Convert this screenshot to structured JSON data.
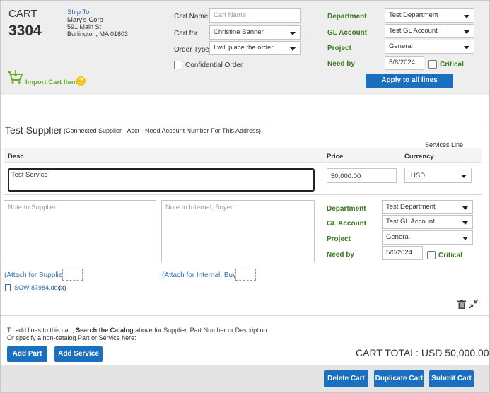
{
  "header": {
    "cart_label": "CART",
    "cart_number": "3304",
    "ship_to_label": "Ship To",
    "ship_to_name": "Mary's Corp",
    "ship_to_street": "591 Main St",
    "ship_to_city": "Burlington, MA 01803",
    "cart_name_label": "Cart Name",
    "cart_name_placeholder": "Cart Name",
    "cart_for_label": "Cart for",
    "cart_for_value": "Christine Banner",
    "order_type_label": "Order Type",
    "order_type_value": "I will place the order",
    "confidential_label": "Confidential Order",
    "department_label": "Department",
    "department_value": "Test Department",
    "gl_account_label": "GL Account",
    "gl_account_value": "Test GL Account",
    "project_label": "Project",
    "project_value": "General",
    "need_by_label": "Need by",
    "need_by_value": "5/6/2024",
    "critical_label": "Critical",
    "import_label": "Import Cart Items",
    "help_glyph": "?",
    "apply_label": "Apply to all lines"
  },
  "supplier": {
    "name": "Test Supplier",
    "note": "(Connected Supplier - Acct - Need Account Number For This Address)",
    "services_line_label": "Services Line",
    "desc_header": "Desc",
    "price_header": "Price",
    "currency_header": "Currency",
    "desc_value": "Test Service",
    "price_value": "50,000.00",
    "currency_value": "USD",
    "note_supplier_placeholder": "Note to Supplier",
    "note_internal_placeholder": "Note to Internal, Buyer",
    "department_label": "Department",
    "department_value": "Test Department",
    "gl_account_label": "GL Account",
    "gl_account_value": "Test GL Account",
    "project_label": "Project",
    "project_value": "General",
    "need_by_label": "Need by",
    "need_by_value": "5/6/2024",
    "critical_label": "Critical",
    "attach_supplier_label": "(Attach for Supplier)",
    "attach_internal_label": "(Attach for Internal, Buyer)",
    "attachment_name": "SOW 87984.docx",
    "attachment_remove": "(x)"
  },
  "footer": {
    "hint_line1_prefix": "To add lines to this cart, ",
    "hint_line1_bold": "Search the Catalog",
    "hint_line1_suffix": " above for Supplier, Part Number or Description.",
    "hint_line2": "Or specify a non-catalog Part or Service here:",
    "add_part_label": "Add Part",
    "add_service_label": "Add Service",
    "cart_total": "CART TOTAL: USD 50,000.00",
    "delete_cart_label": "Delete Cart",
    "duplicate_cart_label": "Duplicate Cart",
    "submit_cart_label": "Submit Cart"
  },
  "colors": {
    "accent_blue": "#1a6fbf",
    "label_green": "#3c7a1e",
    "link_blue": "#2f6fb5",
    "header_gray": "#eeeeee",
    "help_yellow": "#f0c419"
  },
  "icons": {
    "cart": "cart-icon",
    "help": "help-icon",
    "file": "file-icon",
    "trash": "trash-icon",
    "collapse": "collapse-arrows-icon"
  }
}
